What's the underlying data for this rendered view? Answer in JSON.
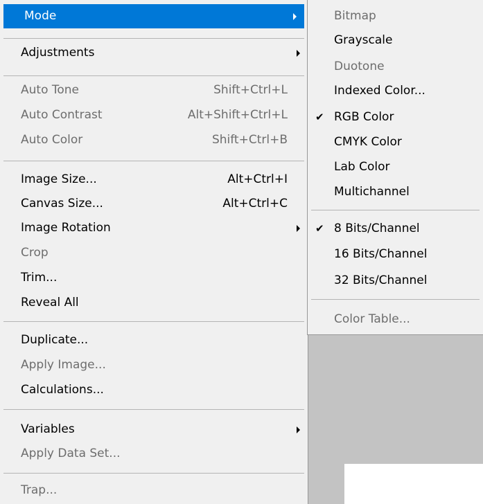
{
  "main_menu": {
    "mode": "Mode",
    "adjustments": "Adjustments",
    "auto_tone": "Auto Tone",
    "auto_tone_shortcut": "Shift+Ctrl+L",
    "auto_contrast": "Auto Contrast",
    "auto_contrast_shortcut": "Alt+Shift+Ctrl+L",
    "auto_color": "Auto Color",
    "auto_color_shortcut": "Shift+Ctrl+B",
    "image_size": "Image Size...",
    "image_size_shortcut": "Alt+Ctrl+I",
    "canvas_size": "Canvas Size...",
    "canvas_size_shortcut": "Alt+Ctrl+C",
    "image_rotation": "Image Rotation",
    "crop": "Crop",
    "trim": "Trim...",
    "reveal_all": "Reveal All",
    "duplicate": "Duplicate...",
    "apply_image": "Apply Image...",
    "calculations": "Calculations...",
    "variables": "Variables",
    "apply_data_set": "Apply Data Set...",
    "trap": "Trap..."
  },
  "mode_submenu": {
    "bitmap": "Bitmap",
    "grayscale": "Grayscale",
    "duotone": "Duotone",
    "indexed_color": "Indexed Color...",
    "rgb_color": "RGB Color",
    "cmyk_color": "CMYK Color",
    "lab_color": "Lab Color",
    "multichannel": "Multichannel",
    "bits_8": "8 Bits/Channel",
    "bits_16": "16 Bits/Channel",
    "bits_32": "32 Bits/Channel",
    "color_table": "Color Table...",
    "check_glyph": "✔"
  },
  "colors": {
    "highlight": "#0078d7",
    "menu_bg": "#f0f0f0",
    "disabled_text": "#6d6d6d",
    "workspace": "#c3c3c3"
  }
}
